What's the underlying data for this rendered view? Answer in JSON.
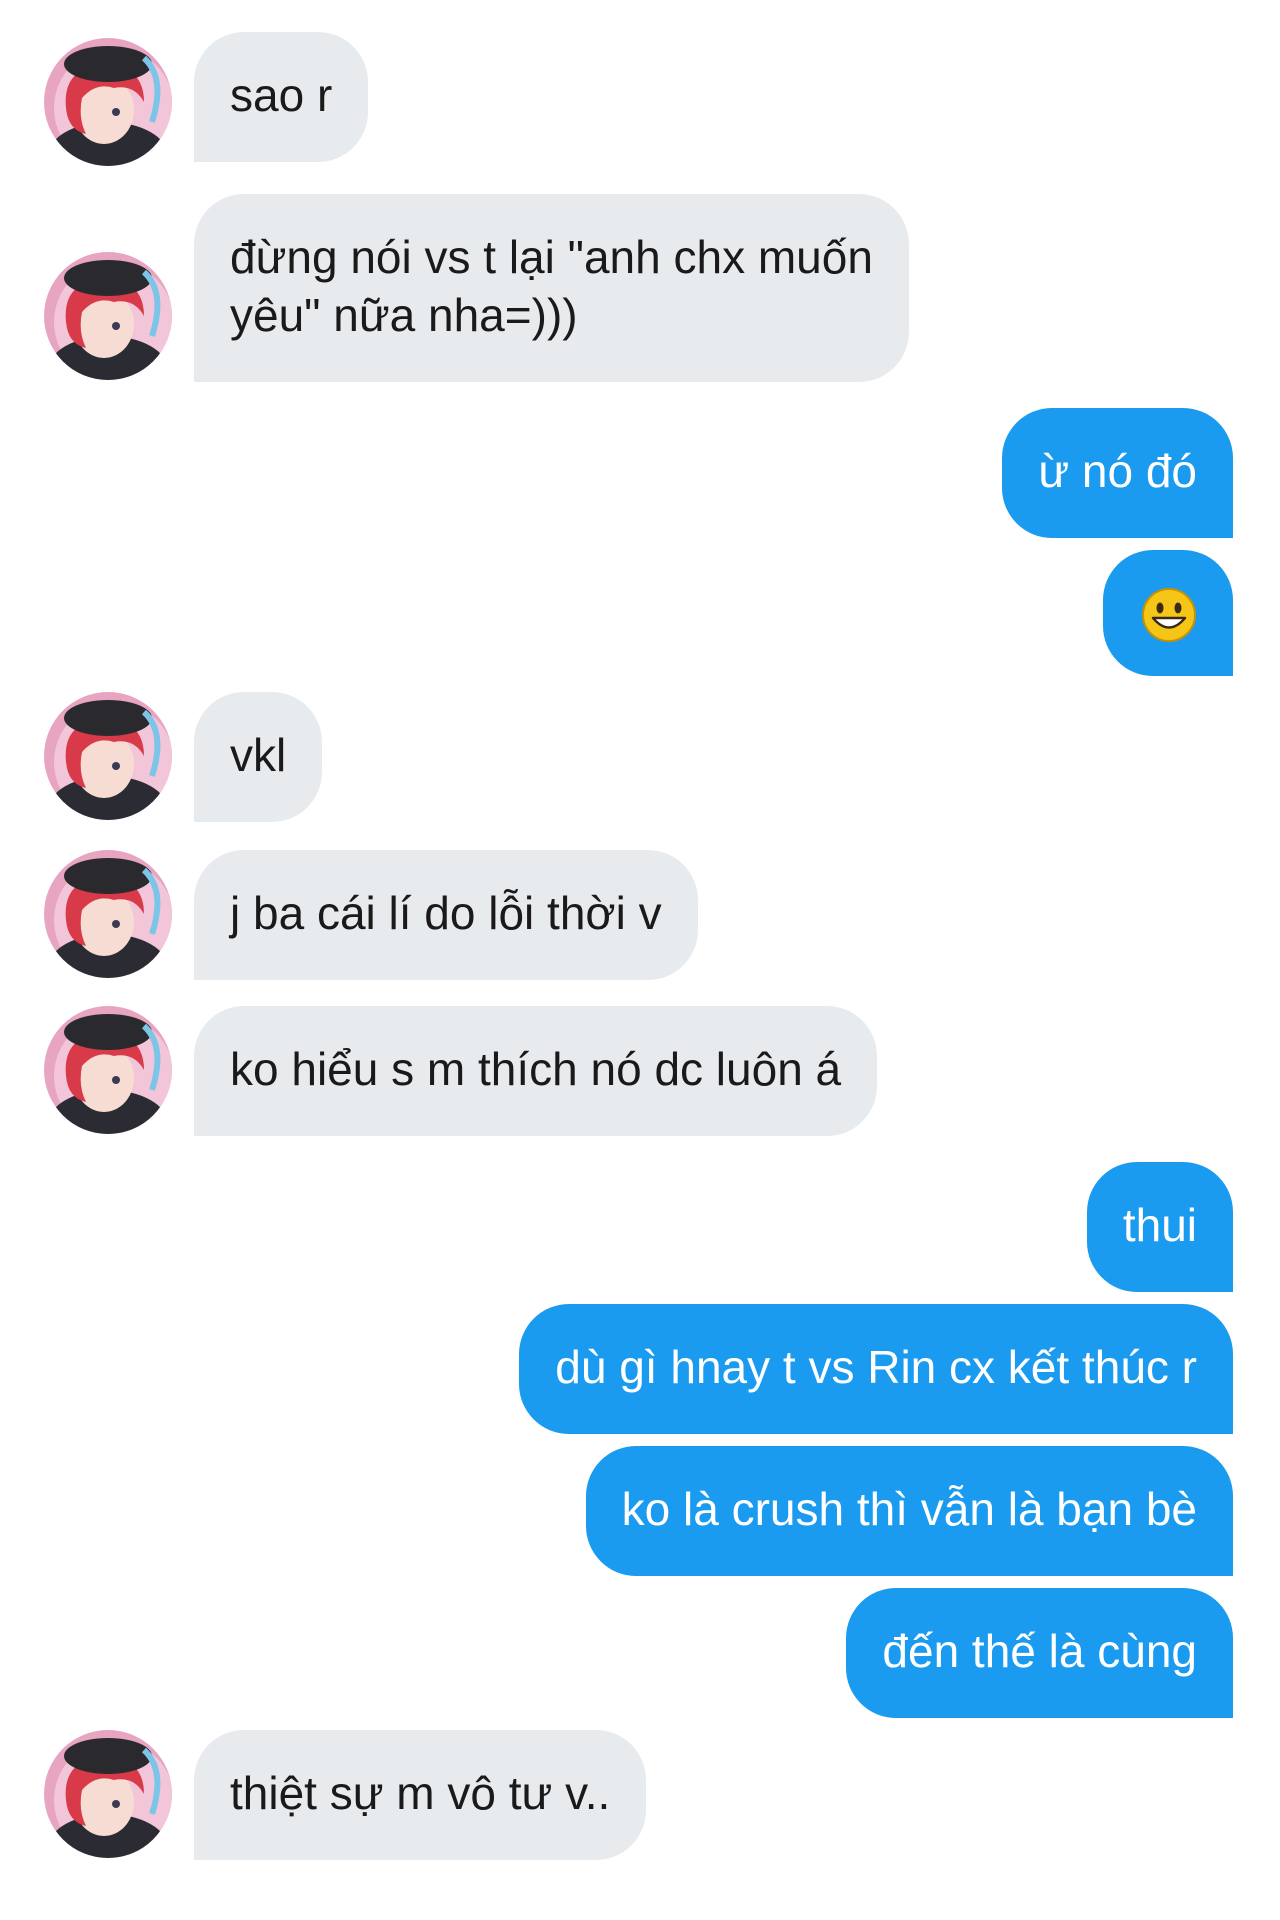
{
  "messages": [
    {
      "side": "in",
      "text": "sao r"
    },
    {
      "side": "in",
      "text": "đừng nói vs t lại \"anh chx muốn\nyêu\" nữa nha=)))"
    },
    {
      "side": "out",
      "text": "ừ nó đó"
    },
    {
      "side": "out",
      "emoji": "grinning-face-emoji"
    },
    {
      "side": "in",
      "text": "vkl"
    },
    {
      "side": "in",
      "text": "j ba cái lí do lỗi thời v"
    },
    {
      "side": "in",
      "text": "ko hiểu s m thích nó dc luôn á"
    },
    {
      "side": "out",
      "text": "thui"
    },
    {
      "side": "out",
      "text": "dù gì hnay t vs Rin cx kết thúc r"
    },
    {
      "side": "out",
      "text": "ko là crush thì vẫn là bạn bè"
    },
    {
      "side": "out",
      "text": "đến thế là cùng"
    },
    {
      "side": "in",
      "text": "thiệt sự m vô tư v.."
    }
  ],
  "avatar": {
    "icon": "contact-avatar-anime-character",
    "hair_color": "#d83a4a",
    "hat_color": "#2a2a2e",
    "background_color": "#e8a5c2"
  },
  "colors": {
    "incoming_bubble": "#e8ebee",
    "outgoing_bubble": "#1a9bf0",
    "incoming_text": "#1a1a1a",
    "outgoing_text": "#ffffff",
    "page_background": "#ffffff"
  }
}
